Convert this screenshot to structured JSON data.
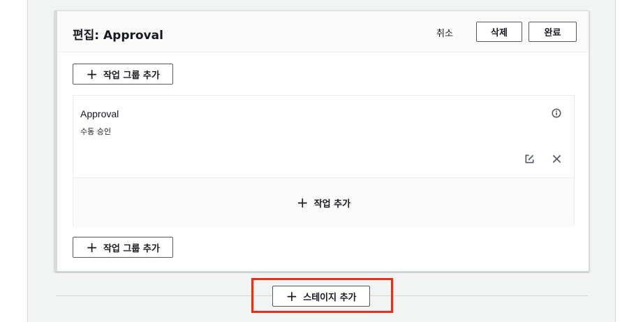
{
  "panel": {
    "title": "편집: Approval",
    "cancel_label": "취소",
    "delete_label": "삭제",
    "done_label": "완료"
  },
  "action_group": {
    "add_group_label": "작업 그룹 추가",
    "action": {
      "name": "Approval",
      "type": "수동 승인"
    },
    "add_action_label": "작업 추가"
  },
  "stage": {
    "add_stage_label": "스테이지 추가"
  },
  "icons": {
    "plus": "plus-icon",
    "info": "info-icon",
    "edit": "edit-icon",
    "close": "close-icon"
  },
  "colors": {
    "highlight": "#e8311a",
    "background": "#f2f3f3",
    "border": "#545b64"
  }
}
